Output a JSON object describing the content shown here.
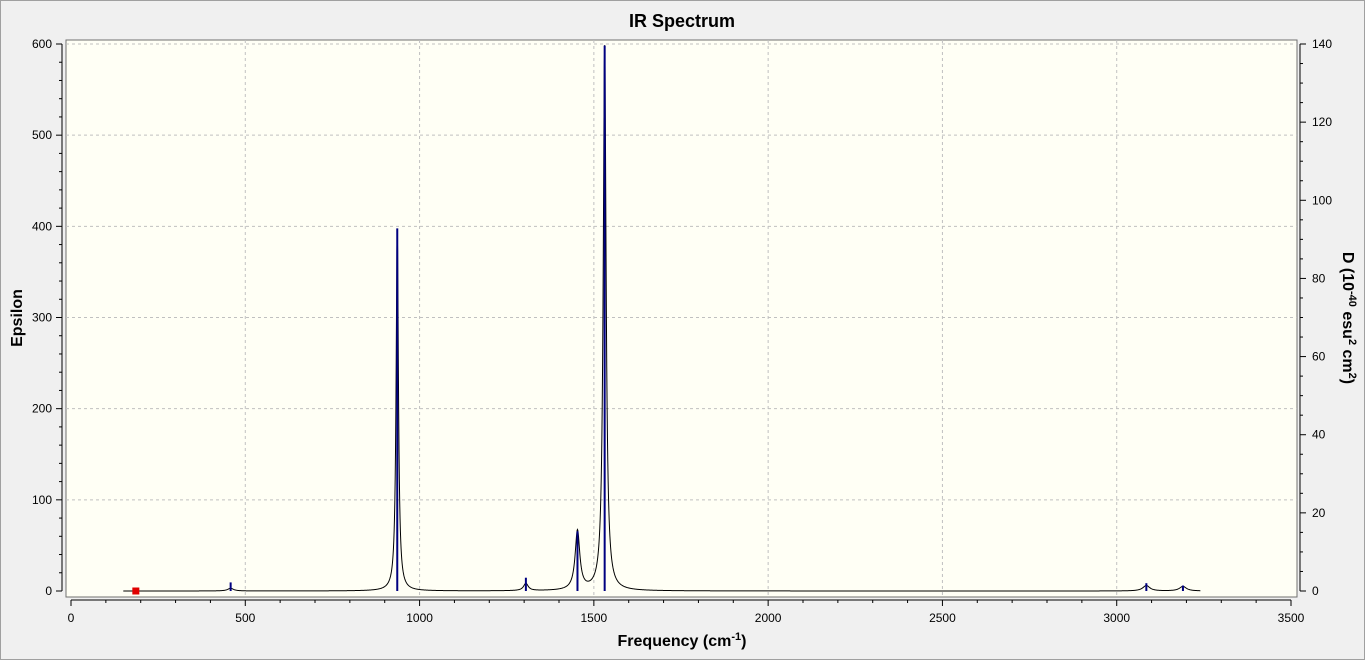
{
  "chart_data": {
    "type": "line",
    "title": "IR Spectrum",
    "xlabel_main": "Frequency (cm",
    "xlabel_sup": "-1",
    "xlabel_end": ")",
    "ylabel": "Epsilon",
    "y2label_parts": [
      "D (10",
      "-40",
      " esu",
      "2",
      " cm",
      "2",
      ")"
    ],
    "xlim": [
      0,
      3500
    ],
    "ylim": [
      0,
      600
    ],
    "y2lim": [
      0,
      140
    ],
    "xticks": [
      0,
      500,
      1000,
      1500,
      2000,
      2500,
      3000,
      3500
    ],
    "yticks": [
      0,
      100,
      200,
      300,
      400,
      500,
      600
    ],
    "y2ticks": [
      0,
      20,
      40,
      60,
      80,
      100,
      120,
      140
    ],
    "grid": true,
    "colors": {
      "plot_bg": "#fffff5",
      "curve": "#000000",
      "sticks": "#000080",
      "marker": "#e00000",
      "grid": "#c0c0c0"
    },
    "peaks": [
      {
        "x": 458,
        "epsilon": 3,
        "width": 10
      },
      {
        "x": 936,
        "epsilon": 397,
        "width": 4
      },
      {
        "x": 1305,
        "epsilon": 8,
        "width": 8
      },
      {
        "x": 1453,
        "epsilon": 65,
        "width": 8
      },
      {
        "x": 1531,
        "epsilon": 598,
        "width": 5
      },
      {
        "x": 3085,
        "epsilon": 6,
        "width": 12
      },
      {
        "x": 3190,
        "epsilon": 5,
        "width": 12
      }
    ],
    "sticks": [
      {
        "x": 458,
        "d": 2.2
      },
      {
        "x": 936,
        "d": 92.8
      },
      {
        "x": 1305,
        "d": 3.4
      },
      {
        "x": 1453,
        "d": 15.3
      },
      {
        "x": 1531,
        "d": 139.6
      },
      {
        "x": 3085,
        "d": 2.0
      },
      {
        "x": 3190,
        "d": 1.4
      }
    ],
    "marker": {
      "x": 186,
      "y": 0
    }
  }
}
